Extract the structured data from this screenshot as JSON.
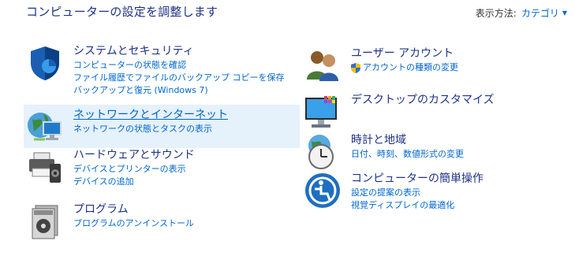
{
  "title": "コンピューターの設定を調整します",
  "view_by": {
    "label": "表示方法:",
    "value": "カテゴリ"
  },
  "categories_left": [
    {
      "heading": "システムとセキュリティ",
      "links": [
        "コンピューターの状態を確認",
        "ファイル履歴でファイルのバックアップ コピーを保存",
        "バックアップと復元 (Windows 7)"
      ],
      "icon": "shield-icon"
    },
    {
      "heading": "ネットワークとインターネット",
      "links": [
        "ネットワークの状態とタスクの表示"
      ],
      "icon": "network-icon"
    },
    {
      "heading": "ハードウェアとサウンド",
      "links": [
        "デバイスとプリンターの表示",
        "デバイスの追加"
      ],
      "icon": "printer-icon"
    },
    {
      "heading": "プログラム",
      "links": [
        "プログラムのアンインストール"
      ],
      "icon": "programs-icon"
    }
  ],
  "categories_right": [
    {
      "heading": "ユーザー アカウント",
      "links": [
        "アカウントの種類の変更"
      ],
      "icon": "users-icon"
    },
    {
      "heading": "デスクトップのカスタマイズ",
      "links": [],
      "icon": "monitor-icon"
    },
    {
      "heading": "時計と地域",
      "links": [
        "日付、時刻、数値形式の変更"
      ],
      "icon": "clock-icon"
    },
    {
      "heading": "コンピューターの簡単操作",
      "links": [
        "設定の提案の表示",
        "視覚ディスプレイの最適化"
      ],
      "icon": "ease-of-access-icon"
    }
  ],
  "colors": {
    "heading": "#1e3287",
    "link": "#0066cc",
    "highlight_bg": "#e5f1fb"
  }
}
